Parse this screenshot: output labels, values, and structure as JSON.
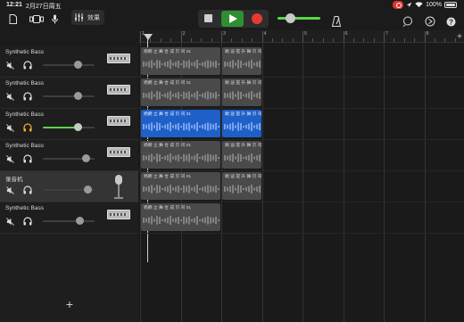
{
  "status": {
    "time": "12:21",
    "date": "2月27日周五",
    "battery": "100%"
  },
  "toolbar": {
    "fx_label": "效果",
    "master_volume": 0.3
  },
  "tracks": [
    {
      "name": "Synthetic Bass",
      "volume": 0.68,
      "active": false,
      "kind": "synth"
    },
    {
      "name": "Synthetic Bass",
      "volume": 0.68,
      "active": false,
      "kind": "synth"
    },
    {
      "name": "Synthetic Bass",
      "volume": 0.68,
      "active": true,
      "kind": "synth"
    },
    {
      "name": "Synthetic Bass",
      "volume": 0.82,
      "active": false,
      "kind": "synth"
    },
    {
      "name": "录音机",
      "volume": 0.86,
      "active": false,
      "kind": "mic",
      "selected": true
    },
    {
      "name": "Synthetic Bass",
      "volume": 0.7,
      "active": false,
      "kind": "synth"
    }
  ],
  "ruler": [
    "1",
    "2",
    "3",
    "4",
    "5",
    "6",
    "7",
    "8"
  ],
  "regions": [
    {
      "track": 0,
      "label": "杨朗 立 舞 合 成 贝 司 01",
      "start": 1,
      "end": 3,
      "blue": false
    },
    {
      "track": 0,
      "label": "踢 迪 提 升 舞 贝 司",
      "start": 3,
      "end": 4,
      "blue": false
    },
    {
      "track": 1,
      "label": "杨朗 立 舞 合 成 贝 司 01",
      "start": 1,
      "end": 3,
      "blue": false
    },
    {
      "track": 1,
      "label": "踢 迪 提 升 舞 贝 司",
      "start": 3,
      "end": 4,
      "blue": false
    },
    {
      "track": 2,
      "label": "杨朗 立 舞 合 成 贝 司 01",
      "start": 1,
      "end": 3,
      "blue": true
    },
    {
      "track": 2,
      "label": "踢 迪 提 升 舞 贝 司",
      "start": 3,
      "end": 4,
      "blue": true
    },
    {
      "track": 3,
      "label": "杨朗 立 舞 合 成 贝 司 01",
      "start": 1,
      "end": 3,
      "blue": false
    },
    {
      "track": 3,
      "label": "踢 迪 提 升 舞 贝 司",
      "start": 3,
      "end": 4,
      "blue": false
    },
    {
      "track": 4,
      "label": "杨朗 立 舞 合 成 贝 司 01",
      "start": 1,
      "end": 3,
      "blue": false
    },
    {
      "track": 4,
      "label": "踢 迪 提 升 舞 贝 司",
      "start": 3,
      "end": 4,
      "blue": false
    },
    {
      "track": 5,
      "label": "杨朗 立 舞 合 成 贝 司 01",
      "start": 1,
      "end": 3,
      "blue": false
    }
  ],
  "add_track_label": "+",
  "add_section_label": "+",
  "colors": {
    "accent_green": "#5bd64a",
    "record_red": "#e53a2f",
    "region_blue": "#1f5fc8",
    "headphone_active": "#f0b429"
  }
}
